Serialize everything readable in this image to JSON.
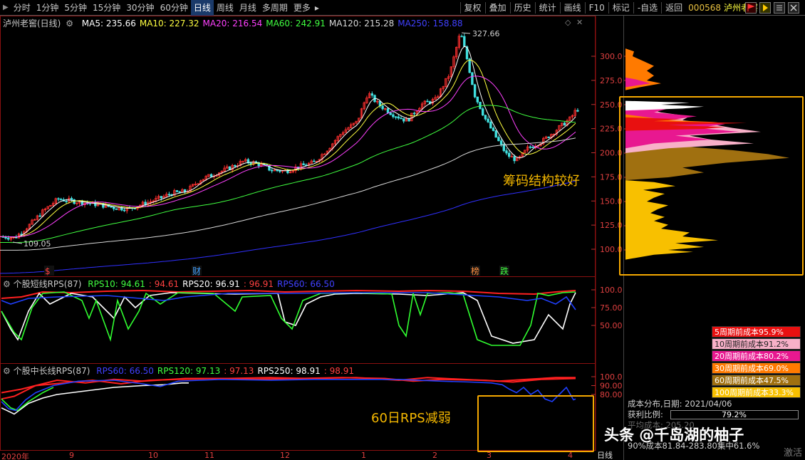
{
  "toolbar": {
    "period_tabs": [
      "分时",
      "1分钟",
      "5分钟",
      "15分钟",
      "30分钟",
      "60分钟",
      "日线",
      "周线",
      "月线",
      "多周期",
      "更多"
    ],
    "active_tab": "日线",
    "grip": "▶",
    "more_arrow": "▸",
    "tools": [
      "复权",
      "叠加",
      "历史",
      "统计",
      "画线",
      "F10",
      "标记",
      "-自选",
      "返回"
    ],
    "stock_code": "000568",
    "stock_name": "泸州老窖"
  },
  "kline_panel": {
    "title": "泸州老窖(日线)",
    "ma_labels": [
      {
        "text": "MA5: 235.66",
        "color": "#ffffff"
      },
      {
        "text": "MA10: 227.32",
        "color": "#ffff40"
      },
      {
        "text": "MA20: 216.54",
        "color": "#ff40ff"
      },
      {
        "text": "MA60: 242.91",
        "color": "#40ff40"
      },
      {
        "text": "MA120: 215.28",
        "color": "#d8d8d8"
      },
      {
        "text": "MA250: 158.88",
        "color": "#4040ff"
      }
    ],
    "price_axis": [
      "300.0",
      "275.0",
      "250.0",
      "225.0",
      "200.0",
      "175.0",
      "150.0",
      "125.0",
      "100.0"
    ],
    "high_label": "327.66",
    "low_label": "109.05",
    "event_markers": [
      {
        "text": "$",
        "color": "#ff4040"
      },
      {
        "text": "财",
        "color": "#40a0ff"
      },
      {
        "text": "榜",
        "color": "#ff9040"
      },
      {
        "text": "跌",
        "color": "#40ff40"
      }
    ]
  },
  "rps_short_panel": {
    "title": "个股短线RPS(87)",
    "labels": [
      {
        "text": "RPS10: 94.61",
        "color": "#40ff40"
      },
      {
        "text": ": 94.61",
        "color": "#ff4040"
      },
      {
        "text": "RPS20: 96.91",
        "color": "#ffffff"
      },
      {
        "text": ": 96.91",
        "color": "#ff4040"
      },
      {
        "text": "RPS60: 66.50",
        "color": "#4040ff"
      }
    ],
    "axis": [
      "100.0",
      "75.00",
      "50.00"
    ]
  },
  "rps_long_panel": {
    "title": "个股中长线RPS(87)",
    "labels": [
      {
        "text": "RPS60: 66.50",
        "color": "#4040ff"
      },
      {
        "text": "RPS120: 97.13",
        "color": "#40ff40"
      },
      {
        "text": ": 97.13",
        "color": "#ff4040"
      },
      {
        "text": "RPS250: 98.91",
        "color": "#ffffff"
      },
      {
        "text": ": 98.91",
        "color": "#ff4040"
      }
    ],
    "axis": [
      "100.0",
      "90.00",
      "80.00"
    ]
  },
  "x_axis": [
    "2020年",
    "9",
    "10",
    "11",
    "12",
    "1",
    "2",
    "3",
    "4"
  ],
  "x_axis_right": "日线",
  "chip_legend": [
    {
      "text": "5周期前成本95.9%",
      "color": "#e81010"
    },
    {
      "text": "10周期前成本91.2%",
      "color": "#f8b0c8"
    },
    {
      "text": "20周期前成本80.2%",
      "color": "#e81890"
    },
    {
      "text": "30周期前成本69.0%",
      "color": "#ff7a00"
    },
    {
      "text": "60周期前成本47.5%",
      "color": "#a07010"
    },
    {
      "text": "100周期前成本33.3%",
      "color": "#f8c000"
    }
  ],
  "chip_info": {
    "date_line": "成本分布,日期:  2021/04/06",
    "ratio_label": "获利比例:",
    "ratio_value": "79.2%",
    "avg_line": "平均成本: 205.20",
    "cost90_line": "90%成本81.84-283.80集中61.6%"
  },
  "annotations": {
    "chip_note": "筹码结构较好",
    "rps_note": "60日RPS减弱"
  },
  "watermark": "头条 @千岛湖的柚子",
  "activate": "激活"
}
